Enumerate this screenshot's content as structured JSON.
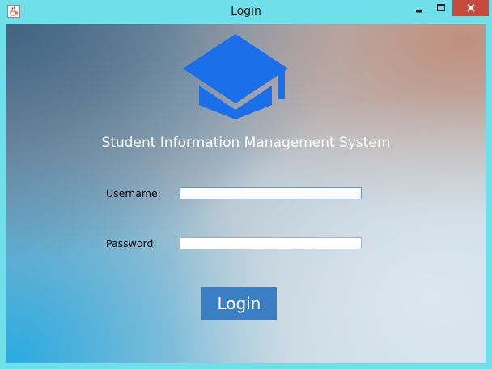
{
  "window": {
    "title": "Login",
    "icon": "java-cup-icon",
    "controls": {
      "minimize_icon": "minimize-icon",
      "maximize_icon": "maximize-icon",
      "close_icon": "close-icon"
    }
  },
  "header": {
    "logo_icon": "graduation-cap-icon",
    "system_title": "Student Information Management System"
  },
  "form": {
    "username_label": "Username:",
    "username_value": "",
    "password_label": "Password:",
    "password_value": ""
  },
  "login_button": {
    "label": "Login"
  },
  "colors": {
    "titlebar": "#6fdfe9",
    "close_button": "#c74a3c",
    "logo_blue": "#1a6ee8",
    "button_blue": "#3a7fc4",
    "title_text": "#ffffff"
  }
}
